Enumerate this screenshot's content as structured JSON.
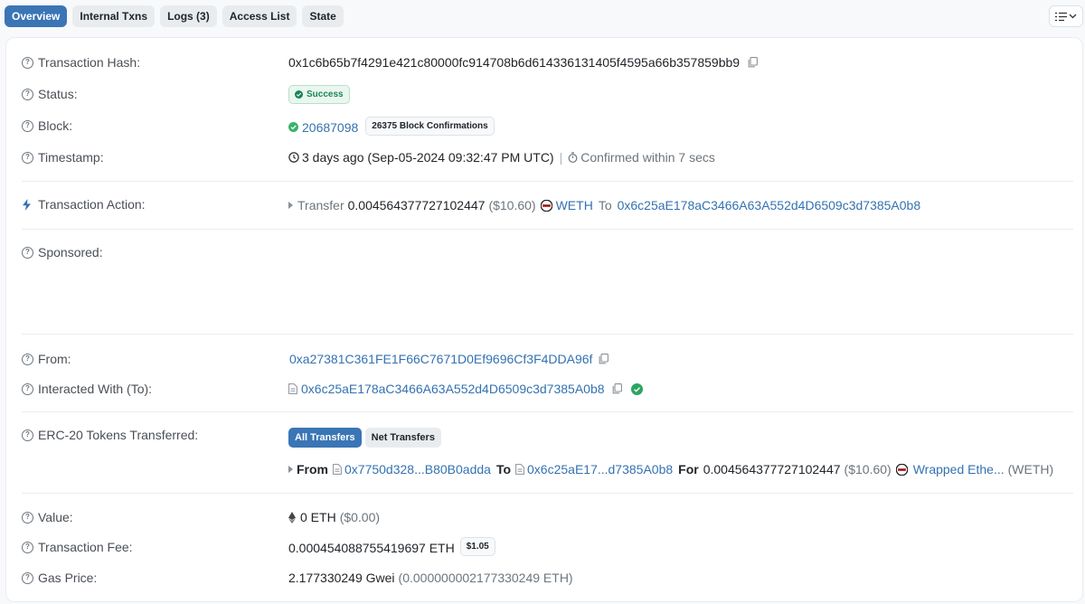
{
  "tabs": [
    {
      "label": "Overview",
      "active": true
    },
    {
      "label": "Internal Txns",
      "active": false
    },
    {
      "label": "Logs (3)",
      "active": false
    },
    {
      "label": "Access List",
      "active": false
    },
    {
      "label": "State",
      "active": false
    }
  ],
  "menu_icon": "list-settings-icon",
  "details": {
    "tx_hash": {
      "label": "Transaction Hash:",
      "value": "0x1c6b65b7f4291e421c80000fc914708b6d614336131405f4595a66b357859bb9"
    },
    "status": {
      "label": "Status:",
      "value": "Success"
    },
    "block": {
      "label": "Block:",
      "number": "20687098",
      "confirmations": "26375 Block Confirmations"
    },
    "timestamp": {
      "label": "Timestamp:",
      "value": "3 days ago (Sep-05-2024 09:32:47 PM UTC)",
      "divider": "|",
      "confirmed": "Confirmed within 7 secs"
    },
    "action": {
      "label": "Transaction Action:",
      "verb": "Transfer",
      "amount": "0.004564377727102447",
      "usd": "($10.60)",
      "token": "WETH",
      "to_word": "To",
      "to_address": "0x6c25aE178aC3466A63A552d4D6509c3d7385A0b8"
    },
    "sponsored": {
      "label": "Sponsored:"
    },
    "from": {
      "label": "From:",
      "address": "0xa27381C361FE1F66C7671D0Ef9696Cf3F4DDA96f"
    },
    "interacted": {
      "label": "Interacted With (To):",
      "address": "0x6c25aE178aC3466A63A552d4D6509c3d7385A0b8"
    },
    "erc20": {
      "label": "ERC-20 Tokens Transferred:",
      "tabs": [
        {
          "label": "All Transfers",
          "active": true
        },
        {
          "label": "Net Transfers",
          "active": false
        }
      ],
      "from_word": "From",
      "from_address": "0x7750d328...B80B0adda",
      "to_word": "To",
      "to_address": "0x6c25aE17...d7385A0b8",
      "for_word": "For",
      "amount": "0.004564377727102447",
      "usd": "($10.60)",
      "token_name": "Wrapped Ethe...",
      "token_symbol": "(WETH)"
    },
    "value": {
      "label": "Value:",
      "amount": "0 ETH",
      "usd": "($0.00)"
    },
    "fee": {
      "label": "Transaction Fee:",
      "amount": "0.000454088755419697 ETH",
      "usd": "$1.05"
    },
    "gas": {
      "label": "Gas Price:",
      "amount": "2.177330249 Gwei",
      "eth": "(0.000000002177330249 ETH)"
    }
  },
  "colors": {
    "accent": "#3a75b5",
    "link": "#3472b1",
    "success": "#198754"
  }
}
